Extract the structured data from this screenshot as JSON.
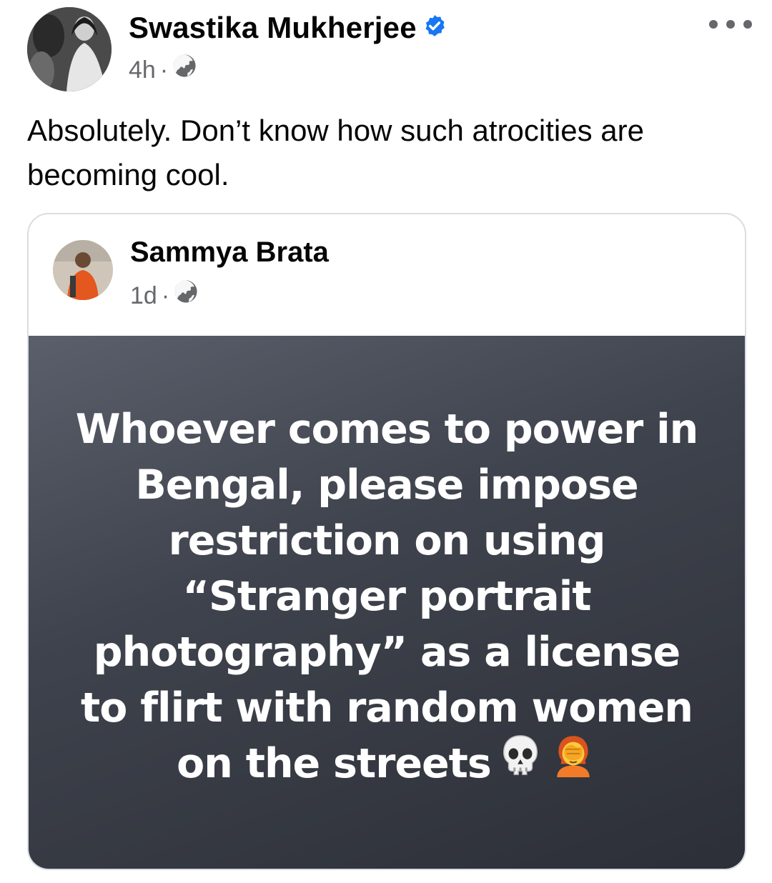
{
  "post": {
    "author": "Swastika Mukherjee",
    "verified": true,
    "time": "4h",
    "separator": "·",
    "audience_icon": "globe-icon",
    "text": "Absolutely. Don’t know how such atrocities are becoming cool."
  },
  "shared_post": {
    "author": "Sammya Brata",
    "time": "1d",
    "separator": "·",
    "audience_icon": "globe-icon",
    "status_text": "Whoever comes to power in Bengal, please impose restriction on using “Stranger portrait photography” as a license to flirt with random women on the streets",
    "emojis": [
      "skull-emoji",
      "facepalm-emoji"
    ]
  },
  "colors": {
    "verified_blue": "#1877f2",
    "meta_gray": "#65676b",
    "status_bg_top": "#5a5f6b",
    "status_bg_bottom": "#2c2f37"
  }
}
